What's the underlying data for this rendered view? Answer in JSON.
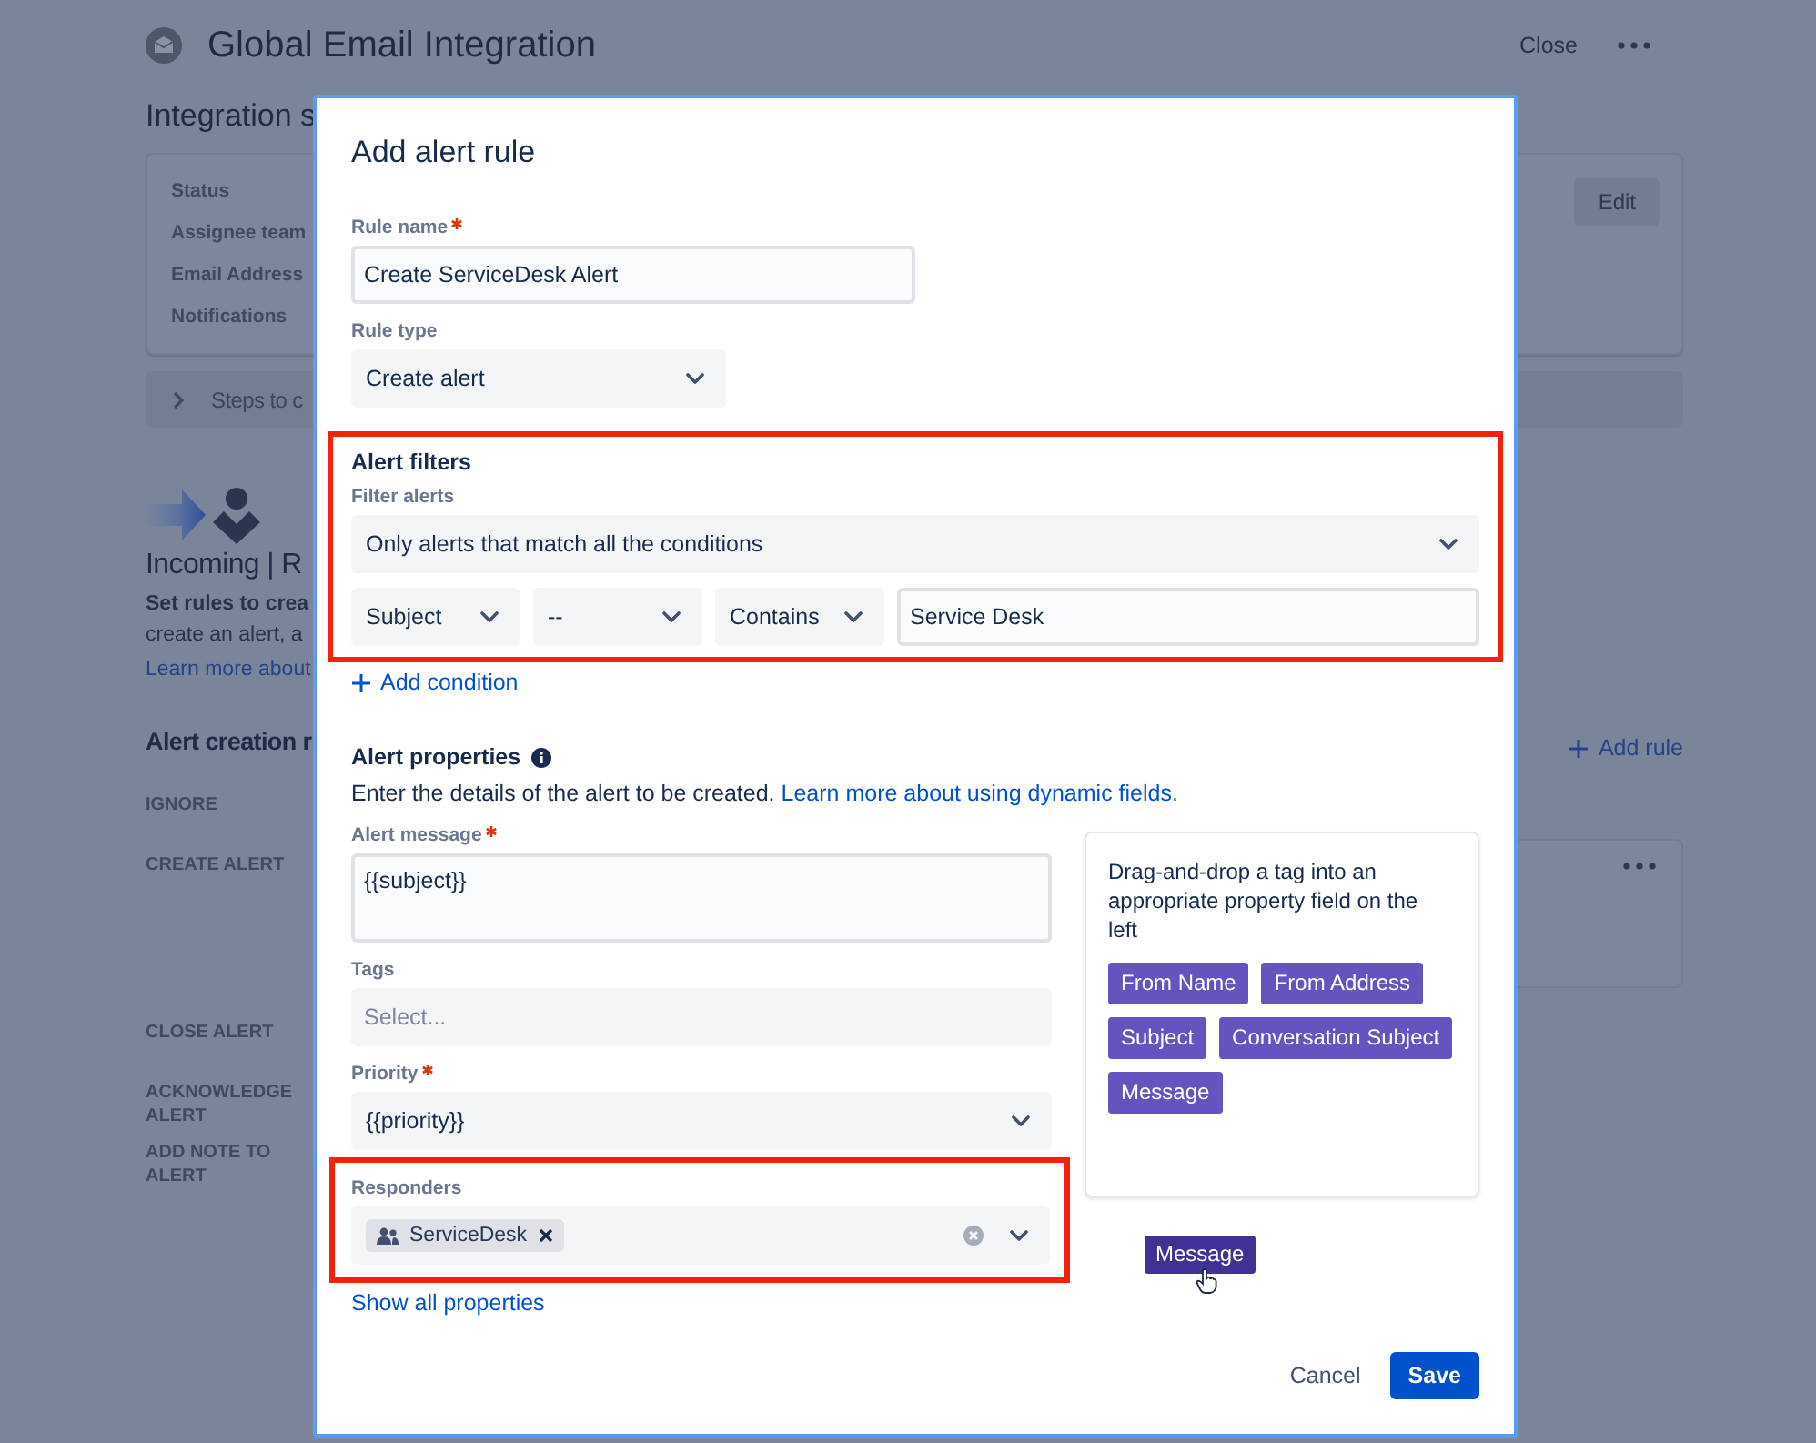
{
  "page": {
    "title": "Global Email Integration",
    "close": "Close",
    "settings": {
      "heading": "Integration s",
      "labels": [
        "Status",
        "Assignee team",
        "Email Address",
        "Notifications"
      ],
      "edit_button": "Edit"
    },
    "steps": "Steps to c",
    "incoming": {
      "heading": "Incoming | R",
      "lines": [
        "Set rules to crea",
        "create an alert, a"
      ],
      "link": "Learn more about"
    },
    "rules": {
      "heading": "Alert creation r",
      "add_button": "Add rule",
      "items": [
        {
          "label": "IGNORE",
          "card": false
        },
        {
          "label": "CREATE ALERT",
          "card": true
        },
        {
          "label": "CLOSE ALERT",
          "card": false
        },
        {
          "label": "ACKNOWLEDGE ALERT",
          "card": false
        },
        {
          "label": "ADD NOTE TO ALERT",
          "card": false
        }
      ]
    }
  },
  "dialog": {
    "title": "Add alert rule",
    "rule_name": {
      "label": "Rule name",
      "required": true,
      "value": "Create ServiceDesk Alert"
    },
    "rule_type": {
      "label": "Rule type",
      "required": false,
      "value": "Create alert"
    },
    "filters": {
      "heading": "Alert filters",
      "highlighted": true,
      "label": "Filter alerts",
      "match": "Only alerts that match all the conditions",
      "conditions": [
        {
          "field": "Subject",
          "operator": "--",
          "comparison": "Contains",
          "value": "Service Desk"
        }
      ],
      "add_button": "Add condition"
    },
    "properties": {
      "heading": "Alert properties",
      "description": "Enter the details of the alert to be created.",
      "link": "Learn more about using dynamic fields.",
      "fields": [
        {
          "kind": "textarea",
          "label": "Alert message",
          "required": true,
          "highlighted": false,
          "value": "{{subject}}"
        },
        {
          "kind": "input",
          "label": "Tags",
          "required": false,
          "highlighted": false,
          "placeholder": "Select..."
        },
        {
          "kind": "select",
          "label": "Priority",
          "required": true,
          "highlighted": false,
          "value": "{{priority}}"
        },
        {
          "kind": "multiselect",
          "label": "Responders",
          "required": false,
          "highlighted": true,
          "chips": [
            "ServiceDesk"
          ]
        }
      ],
      "show_all": "Show all properties",
      "tag_panel": {
        "hint": "Drag-and-drop a tag into an appropriate property field on the left",
        "tags": [
          "From Name",
          "From Address",
          "Subject",
          "Conversation Subject",
          "Message"
        ]
      },
      "dragging_tag": "Message"
    },
    "buttons": {
      "cancel": "Cancel",
      "save": "Save"
    }
  }
}
